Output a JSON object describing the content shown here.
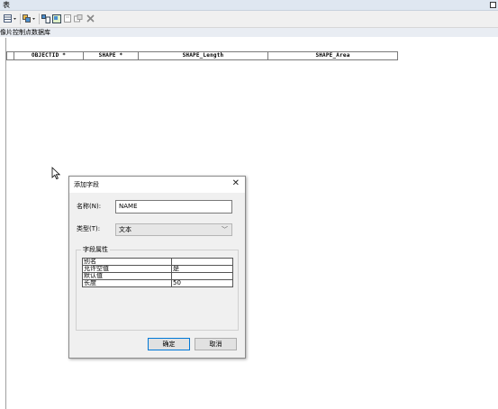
{
  "window": {
    "title": "表"
  },
  "toolbar": {
    "buttons": [
      {
        "icon": "table-options-icon"
      },
      {
        "icon": "related-tables-icon"
      },
      {
        "icon": "select-by-attributes-icon"
      },
      {
        "icon": "switch-selection-icon"
      },
      {
        "icon": "clear-selection-icon"
      },
      {
        "icon": "zoom-to-selected-icon"
      },
      {
        "icon": "delete-selected-icon"
      }
    ]
  },
  "tab": {
    "label": "像片控制点数据库"
  },
  "grid": {
    "columns": [
      "OBJECTID *",
      "SHAPE *",
      "SHAPE_Length",
      "SHAPE_Area"
    ]
  },
  "dialog": {
    "title": "添加字段",
    "close": "✕",
    "name_label": "名称(N):",
    "name_value": "NAME",
    "type_label": "类型(T):",
    "type_value": "文本",
    "props_label": "字段属性",
    "props": [
      {
        "key": "别名",
        "value": ""
      },
      {
        "key": "允许空值",
        "value": "是"
      },
      {
        "key": "默认值",
        "value": ""
      },
      {
        "key": "长度",
        "value": "50"
      }
    ],
    "ok": "确定",
    "cancel": "取消"
  }
}
